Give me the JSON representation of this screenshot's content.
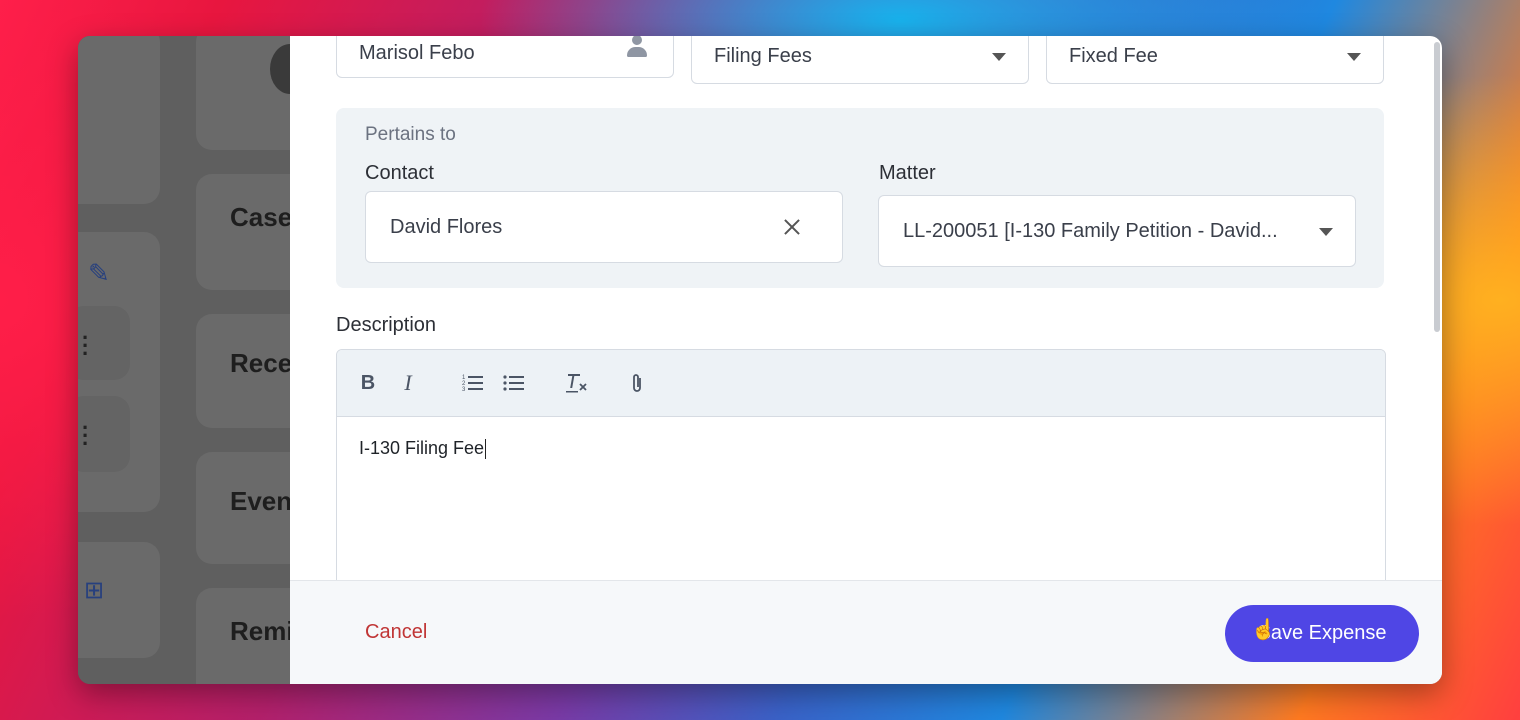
{
  "background_app": {
    "cards": [
      "Case",
      "Rece",
      "Even",
      "Remi"
    ]
  },
  "expense_form": {
    "assignee": "Marisol Febo",
    "category": "Filing Fees",
    "billing_type": "Fixed Fee",
    "pertains_to": {
      "section_label": "Pertains to",
      "contact_label": "Contact",
      "contact_value": "David Flores",
      "matter_label": "Matter",
      "matter_value": "LL-200051 [I-130 Family Petition - David..."
    },
    "description": {
      "label": "Description",
      "toolbar": {
        "bold": "B",
        "italic": "I"
      },
      "content": "I-130 Filing Fee"
    }
  },
  "footer": {
    "cancel_label": "Cancel",
    "save_label": "Save Expense"
  },
  "colors": {
    "primary_button": "#4f46e5",
    "cancel_text": "#c03535"
  }
}
